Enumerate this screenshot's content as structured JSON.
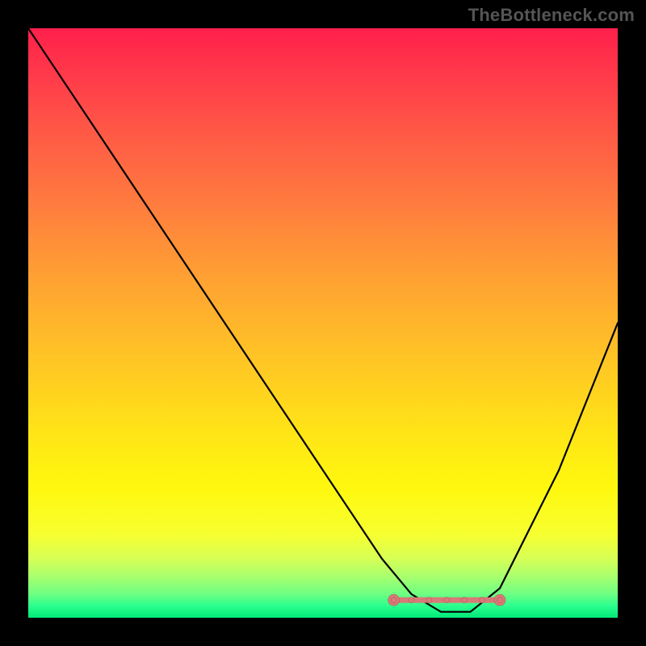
{
  "watermark": "TheBottleneck.com",
  "chart_data": {
    "type": "line",
    "title": "",
    "xlabel": "",
    "ylabel": "",
    "xlim": [
      0,
      100
    ],
    "ylim": [
      0,
      100
    ],
    "grid": false,
    "legend": false,
    "series": [
      {
        "name": "bottleneck-curve",
        "x": [
          0,
          10,
          20,
          30,
          40,
          50,
          60,
          65,
          70,
          75,
          80,
          90,
          100
        ],
        "y": [
          100,
          85,
          70,
          55,
          40,
          25,
          10,
          4,
          1,
          1,
          5,
          25,
          50
        ],
        "color": "#000000"
      }
    ],
    "annotations": {
      "flat_segment": {
        "x_start": 62,
        "x_end": 80,
        "y": 3
      },
      "flat_dots_x": [
        62,
        65,
        68,
        71,
        74,
        77,
        80
      ]
    },
    "background_gradient": {
      "top": "#ff1f4b",
      "mid": "#ffe317",
      "bottom": "#00e878"
    }
  }
}
